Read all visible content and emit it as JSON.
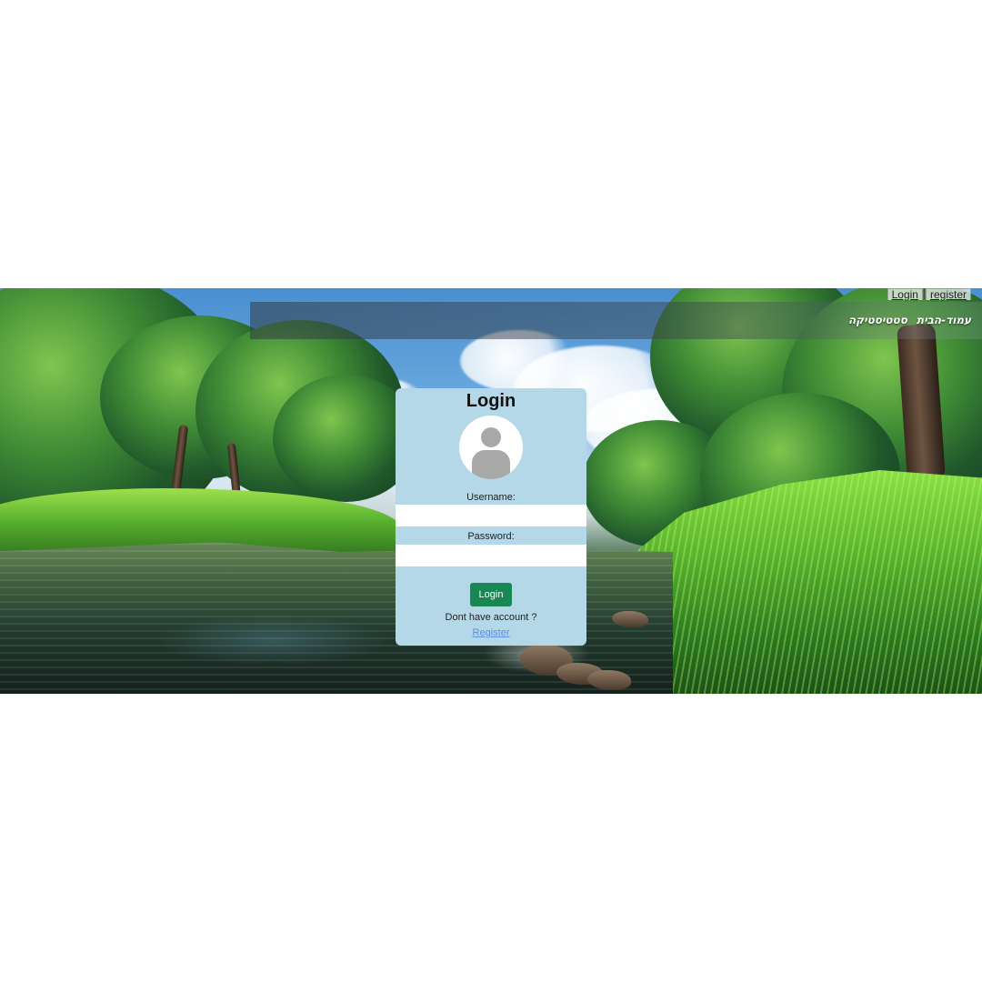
{
  "top_links": {
    "login": "Login",
    "register": "register"
  },
  "main_nav": {
    "home": "עמוד-הבית",
    "statistics": "סטטיסטיקה"
  },
  "login_form": {
    "title": "Login",
    "username_label": "Username:",
    "username_value": "",
    "username_placeholder": "",
    "password_label": "Password:",
    "password_value": "",
    "password_placeholder": "",
    "login_button": "Login",
    "no_account_text": "Dont have account ?",
    "register_link": "Register"
  },
  "icons": {
    "avatar": "user-avatar-icon"
  },
  "colors": {
    "page_background": "#ffffff",
    "panel_background": "#b4d8e7",
    "button_background": "#198754",
    "link_color": "#5b8fe0"
  }
}
